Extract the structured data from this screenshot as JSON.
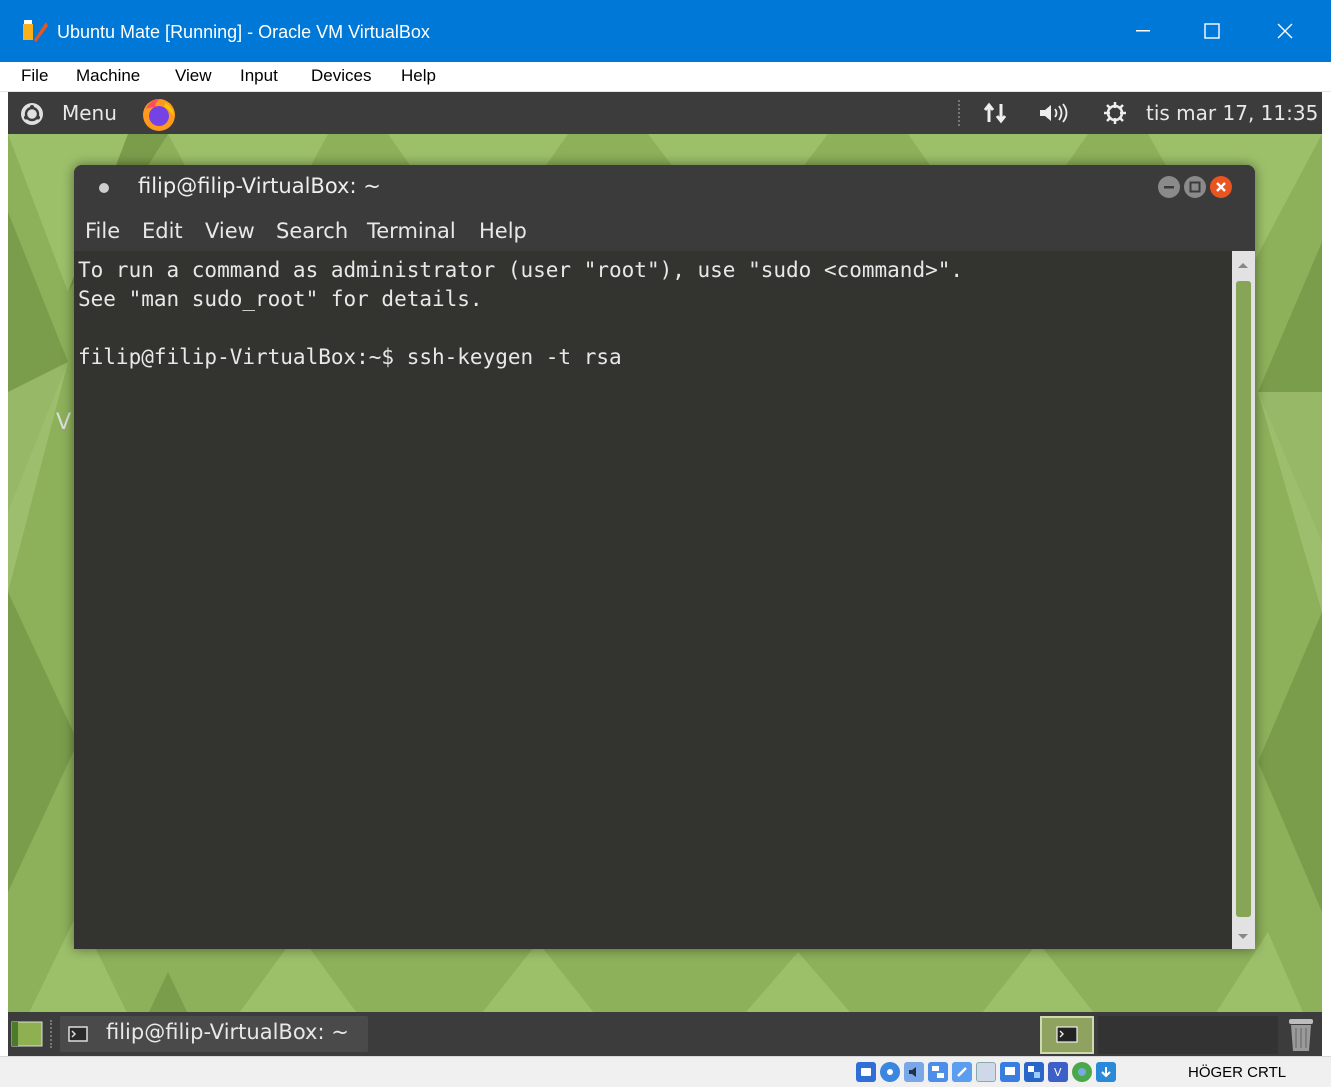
{
  "host": {
    "title": "Ubuntu Mate [Running] - Oracle VM VirtualBox",
    "menu": [
      "File",
      "Machine",
      "View",
      "Input",
      "Devices",
      "Help"
    ],
    "host_key": "HÖGER CRTL",
    "accent": "#0078d7"
  },
  "top_panel": {
    "menu_label": "Menu",
    "clock": "tis mar 17, 11:35"
  },
  "desktop": {
    "partial_label": "V"
  },
  "terminal": {
    "title": "filip@filip-VirtualBox: ~",
    "menu": [
      "File",
      "Edit",
      "View",
      "Search",
      "Terminal",
      "Help"
    ],
    "lines": [
      "To run a command as administrator (user \"root\"), use \"sudo <command>\".",
      "See \"man sudo_root\" for details.",
      "",
      "filip@filip-VirtualBox:~$ ssh-keygen -t rsa"
    ]
  },
  "bottom_panel": {
    "task_label": "filip@filip-VirtualBox: ~"
  },
  "status_icons": [
    "hard-disk-icon",
    "optical-drive-icon",
    "audio-icon",
    "network-icon",
    "usb-icon",
    "shared-folders-icon",
    "display-icon",
    "video-capture-icon",
    "recording-icon",
    "guest-additions-icon",
    "mouse-integration-icon"
  ]
}
